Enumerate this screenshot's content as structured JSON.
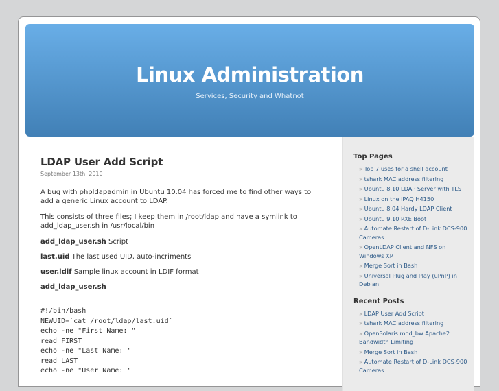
{
  "header": {
    "title": "Linux Administration",
    "description": "Services, Security and Whatnot"
  },
  "post": {
    "title": "LDAP User Add Script",
    "date": "September 13th, 2010",
    "intro": "A bug with phpldapadmin in Ubuntu 10.04 has forced me to find other ways to add a generic Linux account to LDAP.",
    "files_intro": "This consists of three files; I keep them in /root/ldap and have a symlink to add_ldap_user.sh in /usr/local/bin",
    "files": [
      {
        "name": "add_ldap_user.sh",
        "desc": " Script"
      },
      {
        "name": "last.uid",
        "desc": " The last used UID, auto-incriments"
      },
      {
        "name": "user.ldif",
        "desc": " Sample linux account in LDIF format"
      }
    ],
    "code_heading": "add_ldap_user.sh",
    "code_lines": [
      "#!/bin/bash",
      "NEWUID=`cat /root/ldap/last.uid`",
      "echo -ne \"First Name: \"",
      "read FIRST",
      "echo -ne \"Last Name: \"",
      "read LAST",
      "echo -ne \"User Name: \""
    ]
  },
  "sidebar": {
    "bullet": "»",
    "top_pages_heading": "Top Pages",
    "top_pages": [
      "Top 7 uses for a shell account",
      "tshark MAC address filtering",
      "Ubuntu 8.10 LDAP Server with TLS",
      "Linux on the iPAQ H4150",
      "Ubuntu 8.04 Hardy LDAP Client",
      "Ubuntu 9.10 PXE Boot",
      "Automate Restart of D-Link DCS-900 Cameras",
      "OpenLDAP Client and NFS on Windows XP",
      "Merge Sort in Bash",
      "Universal Plug and Play (uPnP) in Debian"
    ],
    "recent_posts_heading": "Recent Posts",
    "recent_posts": [
      "LDAP User Add Script",
      "tshark MAC address filtering",
      "OpenSolaris mod_bw Apache2 Bandwidth Limiting",
      "Merge Sort in Bash",
      "Automate Restart of D-Link DCS-900 Cameras"
    ]
  }
}
